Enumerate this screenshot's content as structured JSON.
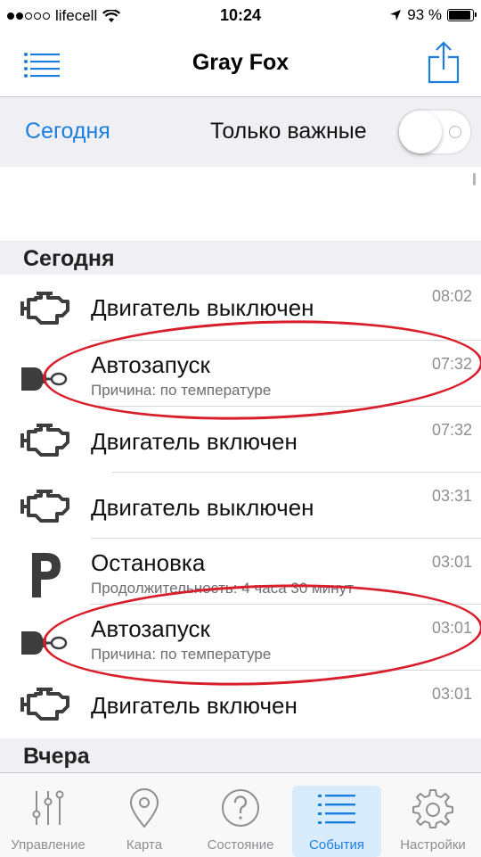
{
  "status_bar": {
    "carrier": "lifecell",
    "time": "10:24",
    "battery": "93 %",
    "battery_level": 0.93,
    "signal_bars_filled": 2,
    "signal_bars_total": 5
  },
  "nav": {
    "title": "Gray Fox",
    "menu_icon": "list-menu-icon",
    "share_icon": "share-icon"
  },
  "filter": {
    "today_label": "Сегодня",
    "important_label": "Только важные",
    "important_enabled": false
  },
  "sections": [
    {
      "title": "Сегодня",
      "events": [
        {
          "icon": "engine-icon",
          "title": "Двигатель выключен",
          "subtitle": "",
          "time": "08:02"
        },
        {
          "icon": "autostart-key-icon",
          "title": "Автозапуск",
          "subtitle": "Причина: по температуре",
          "time": "07:32"
        },
        {
          "icon": "engine-icon",
          "title": "Двигатель включен",
          "subtitle": "",
          "time": "07:32"
        },
        {
          "icon": "engine-icon",
          "title": "Двигатель выключен",
          "subtitle": "",
          "time": "03:31"
        },
        {
          "icon": "parking-icon",
          "title": "Остановка",
          "subtitle": "Продолжительность: 4 часа 30 минут",
          "time": "03:01"
        },
        {
          "icon": "autostart-key-icon",
          "title": "Автозапуск",
          "subtitle": "Причина: по температуре",
          "time": "03:01"
        },
        {
          "icon": "engine-icon",
          "title": "Двигатель включен",
          "subtitle": "",
          "time": "03:01"
        }
      ]
    },
    {
      "title": "Вчера",
      "events": []
    }
  ],
  "annotations": {
    "circle_color": "#d81e2a"
  },
  "tabs": [
    {
      "label": "Управление",
      "icon": "sliders-icon",
      "active": false
    },
    {
      "label": "Карта",
      "icon": "map-pin-icon",
      "active": false
    },
    {
      "label": "Состояние",
      "icon": "question-icon",
      "active": false
    },
    {
      "label": "События",
      "icon": "events-list-icon",
      "active": true
    },
    {
      "label": "Настройки",
      "icon": "gear-icon",
      "active": false
    }
  ],
  "colors": {
    "accent": "#1a7fe0",
    "inactive": "#8e8e93",
    "section_bg": "#efeff4"
  }
}
